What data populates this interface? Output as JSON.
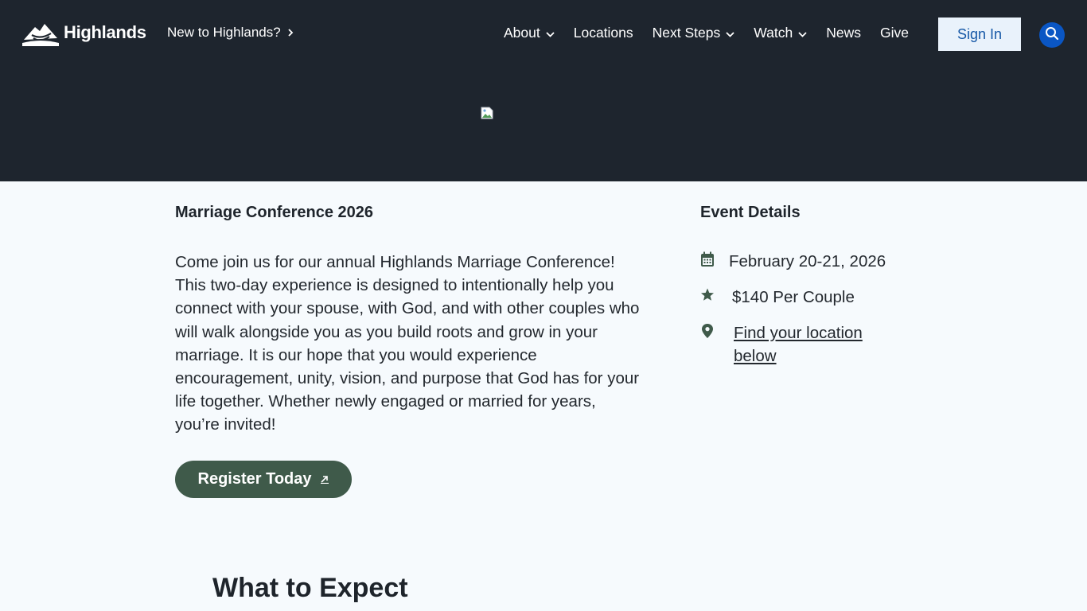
{
  "header": {
    "logo_text": "Highlands",
    "new_link": "New to Highlands?",
    "nav": [
      {
        "label": "About",
        "dropdown": true
      },
      {
        "label": "Locations",
        "dropdown": false
      },
      {
        "label": "Next Steps",
        "dropdown": true
      },
      {
        "label": "Watch",
        "dropdown": true
      },
      {
        "label": "News",
        "dropdown": false
      },
      {
        "label": "Give",
        "dropdown": false
      }
    ],
    "signin_label": "Sign In",
    "search_icon": "search-icon"
  },
  "event": {
    "title": "Marriage Conference 2026",
    "description": "Come join us for our annual Highlands Marriage Conference! This two-day experience is designed to intentionally help you connect with your spouse, with God, and with other couples who will walk alongside you as you build roots and grow in your marriage. It is our hope that you would experience encouragement, unity, vision, and purpose that God has for your life together. Whether newly engaged or married for years, you’re invited!",
    "register_label": "Register Today"
  },
  "details": {
    "title": "Event Details",
    "date": "February 20-21, 2026",
    "price": "$140 Per Couple",
    "location_link": "Find your location below"
  },
  "section": {
    "expect_title": "What to Expect"
  },
  "colors": {
    "header_bg": "#1e252e",
    "page_bg": "#f6fafd",
    "accent_green": "#3f5a4a",
    "signin_bg": "#e9f2fb",
    "search_blue": "#0a56c4"
  }
}
